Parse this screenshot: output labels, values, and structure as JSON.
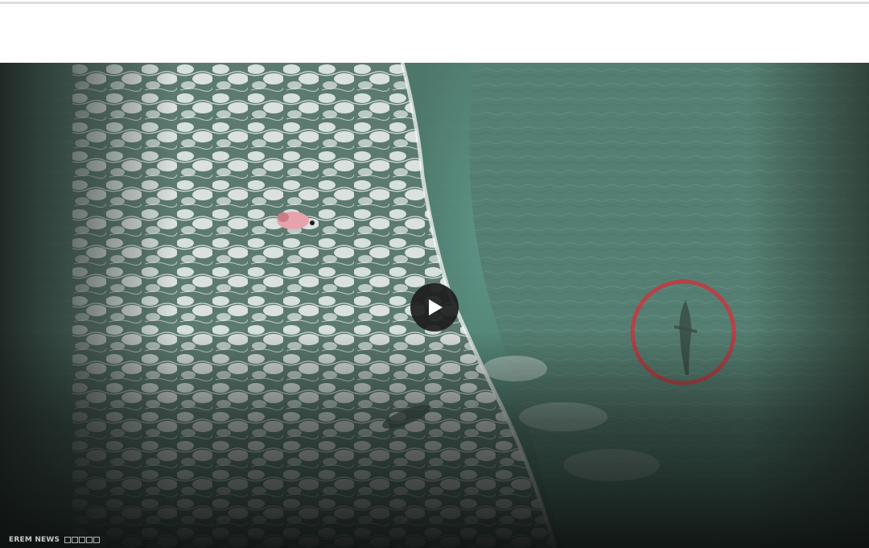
{
  "video": {
    "watermark_brand": "EREM NEWS",
    "play_icon": "play-icon",
    "highlight_color": "#c8373f"
  },
  "colors": {
    "page_background": "#ffffff",
    "divider": "#d9dde1",
    "ocean": "#4f7a6c",
    "foam": "#e6ecea",
    "play_button": "#1c1c1c"
  }
}
